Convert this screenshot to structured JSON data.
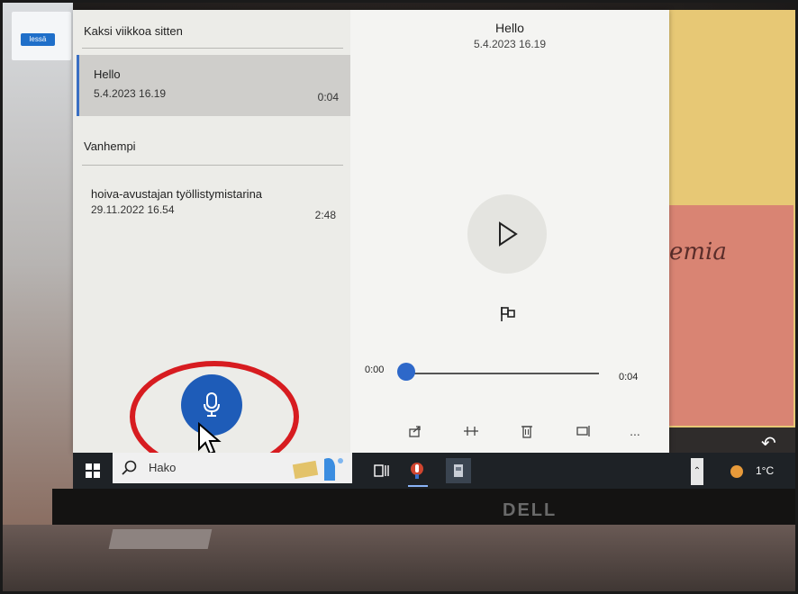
{
  "left_chip_text": "lessä",
  "sticky_note_text": "emia",
  "brand": "DELL",
  "app": {
    "sections": [
      {
        "header": "Kaksi viikkoa sitten",
        "recordings": [
          {
            "title": "Hello",
            "date": "5.4.2023 16.19",
            "duration": "0:04",
            "selected": true
          }
        ]
      },
      {
        "header": "Vanhempi",
        "recordings": [
          {
            "title": "hoiva-avustajan työllistymistarina",
            "date": "29.11.2022 16.54",
            "duration": "2:48",
            "selected": false
          }
        ]
      }
    ],
    "detail": {
      "title": "Hello",
      "date": "5.4.2023 16.19",
      "time_start": "0:00",
      "time_end": "0:04",
      "playback_progress": 0
    },
    "toolbar_icons": [
      "share-icon",
      "trim-icon",
      "delete-icon",
      "rename-icon",
      "more-icon"
    ],
    "more_label": "...",
    "accent_color": "#1e5cb8"
  },
  "taskbar": {
    "search_placeholder": "Hako",
    "temperature": "1°C"
  },
  "annotation": {
    "color": "#d71c20",
    "shape": "ellipse around record button"
  }
}
